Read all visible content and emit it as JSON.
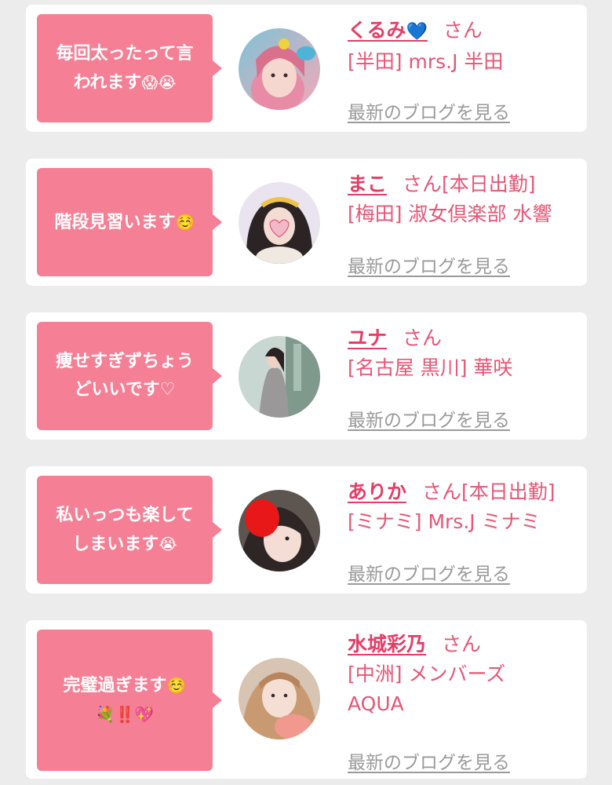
{
  "cards": [
    {
      "comment_line1": "毎回太ったって言",
      "comment_line2": "われます",
      "comment_emoji": "😱😭",
      "name": "くるみ",
      "name_emoji": "💙",
      "honorific": "さん",
      "status": "",
      "area": "[半田]",
      "shop": "mrs.J 半田",
      "shop_line2": "",
      "blog_link": "最新のブログを見る"
    },
    {
      "comment_line1": "階段見習います",
      "comment_line2": "",
      "comment_emoji": "☺️",
      "name": "まこ",
      "name_emoji": "",
      "honorific": "さん",
      "status": "[本日出勤]",
      "area": "[梅田]",
      "shop": "淑女倶楽部 水響",
      "shop_line2": "",
      "blog_link": "最新のブログを見る"
    },
    {
      "comment_line1": "痩せすぎずちょう",
      "comment_line2": "どいいです♡",
      "comment_emoji": "",
      "name": "ユナ",
      "name_emoji": "",
      "honorific": "さん",
      "status": "",
      "area": "[名古屋 黒川]",
      "shop": "華咲",
      "shop_line2": "",
      "blog_link": "最新のブログを見る"
    },
    {
      "comment_line1": "私いっつも楽して",
      "comment_line2": "しまいます",
      "comment_emoji": "😭",
      "name": "ありか",
      "name_emoji": "",
      "honorific": "さん",
      "status": "[本日出勤]",
      "area": "[ミナミ]",
      "shop": "Mrs.J ミナミ",
      "shop_line2": "",
      "blog_link": "最新のブログを見る"
    },
    {
      "comment_line1": "完璧過ぎます",
      "comment_line1_emoji": "☺️",
      "comment_line2": "",
      "comment_emoji": "💐‼️💖",
      "name": "水城彩乃",
      "name_emoji": "",
      "honorific": "さん",
      "status": "",
      "area": "[中洲]",
      "shop": "メンバーズ",
      "shop_line2": "AQUA",
      "blog_link": "最新のブログを見る"
    }
  ],
  "colors": {
    "accent": "#f57f95",
    "name": "#e63c66",
    "text": "#e85575",
    "link": "#9a9a9a",
    "background": "#ececec"
  }
}
